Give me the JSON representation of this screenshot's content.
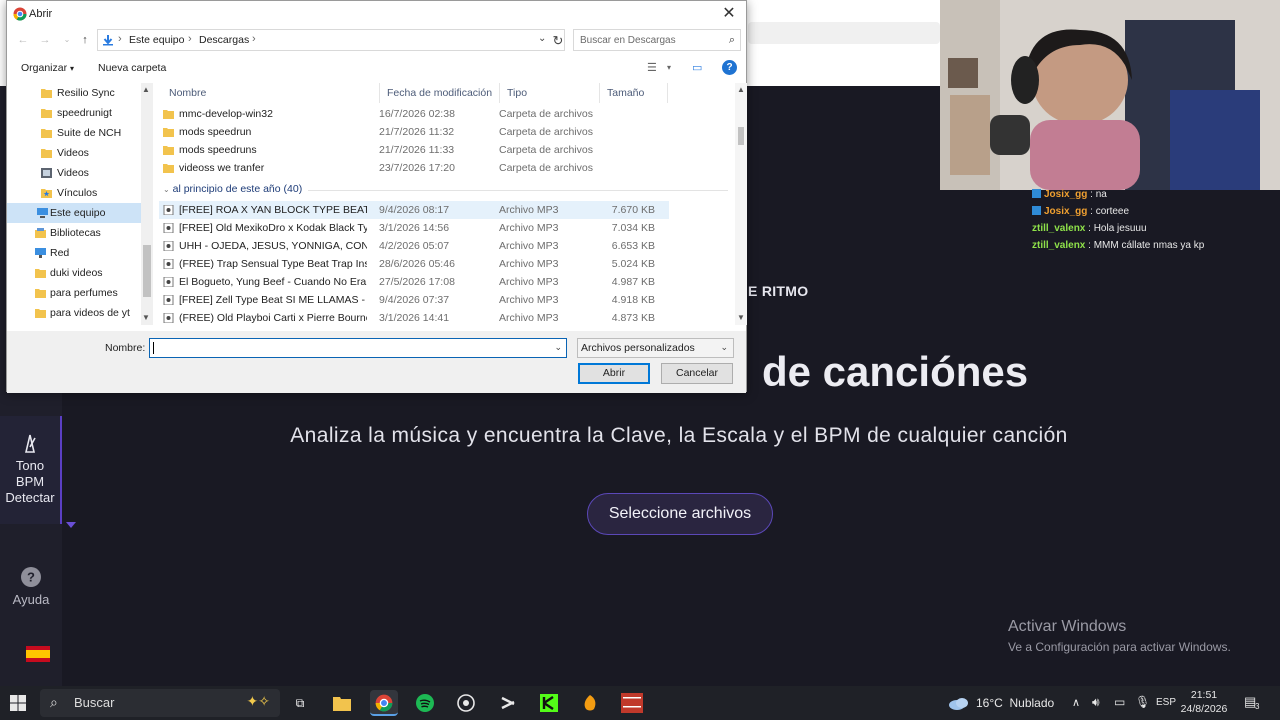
{
  "background": {
    "kicker": "E RITMO",
    "hero_title": "de canciónes",
    "hero_subtitle": "Analiza la música y encuentra la Clave, la Escala y el BPM de cualquier canción",
    "select_button": "Seleccione archivos",
    "sidebar": [
      {
        "label": "Tono\nBPM\nDetectar",
        "icon": "metronome-icon"
      },
      {
        "label": "Ayuda",
        "icon": "question-icon"
      }
    ],
    "activate_windows": {
      "line1": "Activar Windows",
      "line2": "Ve a Configuración para activar Windows."
    }
  },
  "chat": [
    {
      "user": "Josix_gg",
      "text": ": na",
      "color": "#f0a030",
      "badge": true
    },
    {
      "user": "Josix_gg",
      "text": ": corteee",
      "color": "#f0a030",
      "badge": true
    },
    {
      "user": "ztill_valenx",
      "text": ": Hola jesuuu",
      "color": "#8fe24a",
      "badge": false
    },
    {
      "user": "ztill_valenx",
      "text": ": MMM cállate nmas ya kp",
      "color": "#8fe24a",
      "badge": false
    }
  ],
  "dialog": {
    "title": "Abrir",
    "breadcrumb": [
      "Este equipo",
      "Descargas"
    ],
    "search_placeholder": "Buscar en Descargas",
    "toolbar": {
      "organize": "Organizar",
      "new_folder": "Nueva carpeta"
    },
    "nav_items": [
      {
        "label": "Resilio Sync",
        "icon": "folder-icon",
        "indent": 2
      },
      {
        "label": "speedrunigt",
        "icon": "folder-icon",
        "indent": 2
      },
      {
        "label": "Suite de NCH",
        "icon": "folder-icon",
        "indent": 2
      },
      {
        "label": "Videos",
        "icon": "folder-icon",
        "indent": 2
      },
      {
        "label": "Videos",
        "icon": "video-folder-icon",
        "indent": 2
      },
      {
        "label": "Vínculos",
        "icon": "star-folder-icon",
        "indent": 2
      },
      {
        "label": "Este equipo",
        "icon": "computer-icon",
        "indent": 1,
        "selected": true
      },
      {
        "label": "Bibliotecas",
        "icon": "library-icon",
        "indent": 1
      },
      {
        "label": "Red",
        "icon": "network-icon",
        "indent": 1
      },
      {
        "label": "duki videos",
        "icon": "folder-icon",
        "indent": 1
      },
      {
        "label": "para perfumes",
        "icon": "folder-icon",
        "indent": 1
      },
      {
        "label": "para videos de yt",
        "icon": "folder-icon",
        "indent": 1
      }
    ],
    "columns": {
      "name": "Nombre",
      "date": "Fecha de modificación",
      "type": "Tipo",
      "size": "Tamaño"
    },
    "folders": [
      {
        "name": "mmc-develop-win32",
        "date": "16/7/2026 02:38",
        "type": "Carpeta de archivos",
        "size": ""
      },
      {
        "name": "mods speedrun",
        "date": "21/7/2026 11:32",
        "type": "Carpeta de archivos",
        "size": ""
      },
      {
        "name": "mods speedruns",
        "date": "21/7/2026 11:33",
        "type": "Carpeta de archivos",
        "size": ""
      },
      {
        "name": "videoss we tranfer",
        "date": "23/7/2026 17:20",
        "type": "Carpeta de archivos",
        "size": ""
      }
    ],
    "group_label": "al principio de este año (40)",
    "files": [
      {
        "name": "[FREE] ROA X YAN BLOCK TYPE BEAT - V...",
        "date": "9/4/2026 08:17",
        "type": "Archivo MP3",
        "size": "7.670 KB",
        "hover": true
      },
      {
        "name": "[FREE] Old MexikoDro x Kodak Black Typ...",
        "date": "3/1/2026 14:56",
        "type": "Archivo MP3",
        "size": "7.034 KB"
      },
      {
        "name": "UHH - OJEDA, JESUS, YONNIGA, CONDO...",
        "date": "4/2/2026 05:07",
        "type": "Archivo MP3",
        "size": "6.653 KB"
      },
      {
        "name": "(FREE) Trap Sensual Type Beat  Trap Instr...",
        "date": "28/6/2026 05:46",
        "type": "Archivo MP3",
        "size": "5.024 KB"
      },
      {
        "name": "El Bogueto, Yung Beef - Cuando No Era ...",
        "date": "27/5/2026 17:08",
        "type": "Archivo MP3",
        "size": "4.987 KB"
      },
      {
        "name": "[FREE] Zell Type Beat  SI ME LLAMAS  - I...",
        "date": "9/4/2026 07:37",
        "type": "Archivo MP3",
        "size": "4.918 KB"
      },
      {
        "name": "(FREE) Old Playboi Carti x Pierre Bourne x...",
        "date": "3/1/2026 14:41",
        "type": "Archivo MP3",
        "size": "4.873 KB"
      }
    ],
    "filename_label": "Nombre:",
    "filename_value": "",
    "filter_value": "Archivos personalizados",
    "open_button": "Abrir",
    "cancel_button": "Cancelar"
  },
  "taskbar": {
    "search_label": "Buscar",
    "weather": "16°C  Nublado",
    "language": "ESP",
    "time": "21:51",
    "date": "24/8/2026",
    "notification_count": "3"
  },
  "colors": {
    "accent": "#5b48b8",
    "dialog_select": "#cde3f7",
    "link": "#1e3c78"
  }
}
